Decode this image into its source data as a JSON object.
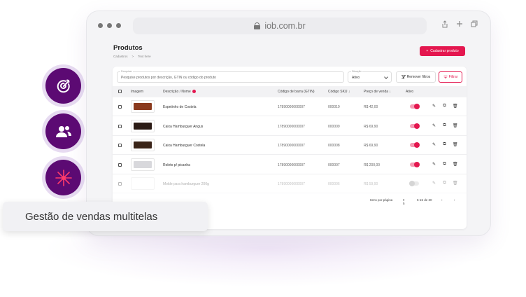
{
  "browser": {
    "url": "iob.com.br"
  },
  "page": {
    "title": "Produtos",
    "breadcrumb": [
      "Cadastros",
      ">",
      "Text here"
    ],
    "create_button": "Cadastrar produto"
  },
  "filters": {
    "search_label": "Pesquisar",
    "search_placeholder": "Pesquise produtos por descrição, GTIN ou código do produto",
    "status_label": "Situação",
    "status_value": "Ativo",
    "clear_label": "Remover filtros",
    "filter_label": "Filtrar"
  },
  "table": {
    "headers": {
      "image": "Imagem",
      "description": "Descrição / Nome",
      "barcode": "Código de barra (GTIN)",
      "sku": "Código SKU",
      "price": "Preço de venda",
      "active": "Ativo"
    },
    "rows": [
      {
        "name": "Espetinho de Costela",
        "barcode": "17890000000007",
        "sku": "000010",
        "price": "R$ 42,00",
        "active": true,
        "thumb_color": "#8a3a1e"
      },
      {
        "name": "Caixa Hamburguer Angus",
        "barcode": "17890000000007",
        "sku": "000009",
        "price": "R$ 69,90",
        "active": true,
        "thumb_color": "#2a1a14"
      },
      {
        "name": "Caixa Hamburguer Costela",
        "barcode": "17890000000007",
        "sku": "000008",
        "price": "R$ 69,90",
        "active": true,
        "thumb_color": "#3a2418"
      },
      {
        "name": "Roleto p/ picanha",
        "barcode": "17890000000007",
        "sku": "000007",
        "price": "R$ 200,00",
        "active": true,
        "thumb_color": "#d8d8dc"
      },
      {
        "name": "Molde para hamburguer 200g",
        "barcode": "17890000000007",
        "sku": "000006",
        "price": "R$ 59,90",
        "active": false,
        "thumb_color": "#ffffff"
      }
    ]
  },
  "pager": {
    "items_label": "Itens por página",
    "per_page": "5",
    "range": "5-15 de 30"
  },
  "caption": "Gestão de vendas multitelas",
  "colors": {
    "accent": "#e4174f",
    "feature_bg": "#5c0a73"
  },
  "icons": [
    "target-icon",
    "users-icon",
    "sparkle-icon"
  ]
}
